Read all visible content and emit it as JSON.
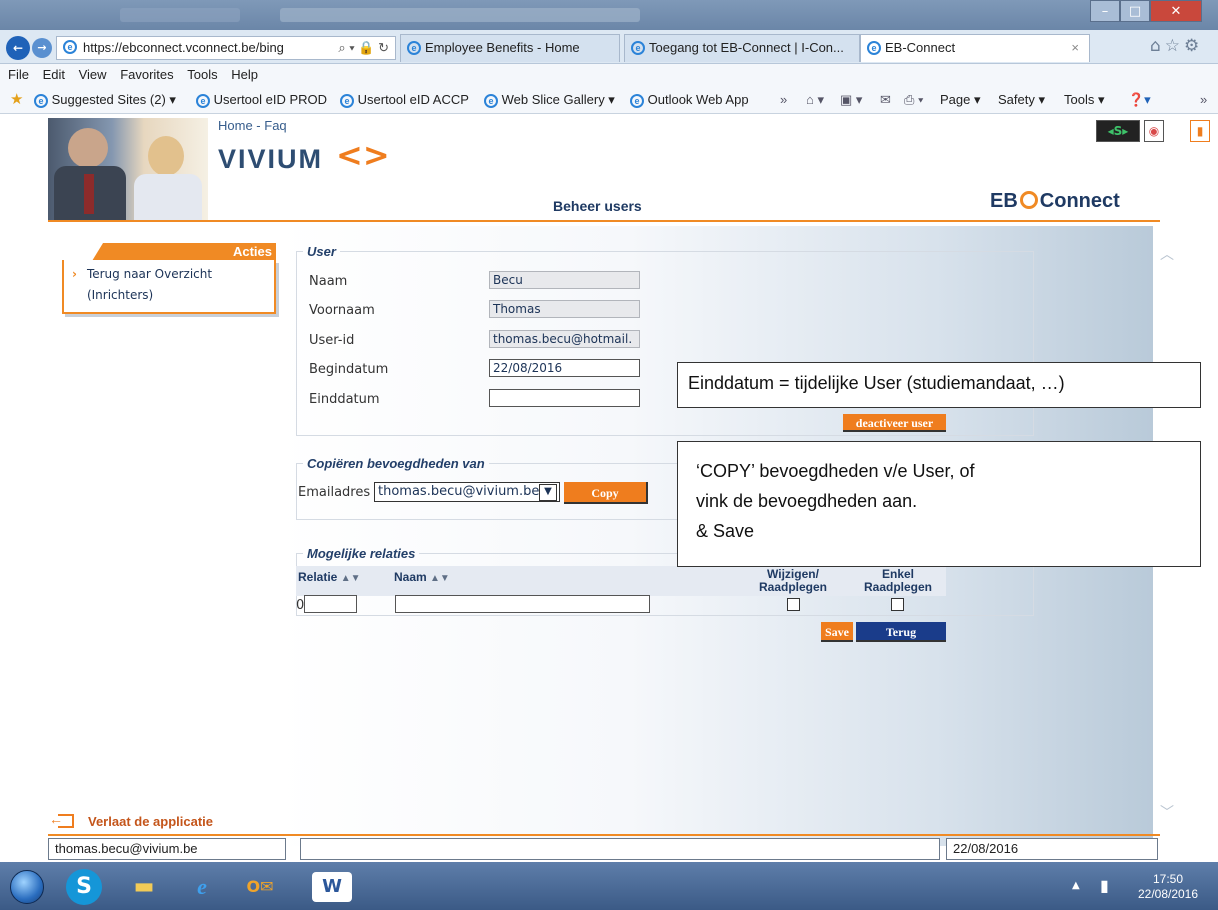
{
  "browser": {
    "url": "https://ebconnect.vconnect.be/bing",
    "tabs": [
      {
        "label": "Employee Benefits - Home"
      },
      {
        "label": "Toegang tot EB-Connect | I-Con..."
      },
      {
        "label": "EB-Connect"
      }
    ],
    "menu": [
      "File",
      "Edit",
      "View",
      "Favorites",
      "Tools",
      "Help"
    ],
    "favorites": [
      "Suggested Sites (2) ▾",
      "Usertool eID PROD",
      "Usertool eID ACCP",
      "Web Slice Gallery ▾",
      "Outlook Web App"
    ],
    "command_bar": [
      "Page ▾",
      "Safety ▾",
      "Tools ▾"
    ]
  },
  "header": {
    "nav_home": "Home",
    "nav_sep": " - ",
    "nav_faq": "Faq",
    "logo": "VIVIUM",
    "page_title": "Beheer users",
    "brand_left": "EB",
    "brand_right": "Connect"
  },
  "sidebar": {
    "title": "Acties",
    "link": "Terug naar Overzicht (Inrichters)"
  },
  "user_section": {
    "legend": "User",
    "fields": [
      {
        "label": "Naam",
        "value": "Becu"
      },
      {
        "label": "Voornaam",
        "value": "Thomas"
      },
      {
        "label": "User-id",
        "value": "thomas.becu@hotmail."
      },
      {
        "label": "Begindatum",
        "value": "22/08/2016"
      },
      {
        "label": "Einddatum",
        "value": ""
      }
    ],
    "deactivate_label": "deactiveer user"
  },
  "copy_section": {
    "legend": "Copiëren bevoegdheden van",
    "email_label": "Emailadres",
    "email_selected": "thomas.becu@vivium.be",
    "copy_label": "Copy"
  },
  "relations": {
    "legend": "Mogelijke relaties",
    "col_relatie": "Relatie",
    "col_naam": "Naam",
    "col_wijzigen": "Wijzigen/ Raadplegen",
    "col_enkel": "Enkel Raadplegen",
    "row_prefix": "0",
    "save_label": "Save",
    "terug_label": "Terug"
  },
  "annotations": {
    "note1": "Einddatum = tijdelijke User (studiemandaat, …)",
    "note2_line1": "‘COPY’ bevoegdheden v/e User, of",
    "note2_line2": "vink de bevoegdheden aan.",
    "note2_line3": "& Save"
  },
  "footer": {
    "exit_label": "Verlaat de applicatie",
    "status_user": "thomas.becu@vivium.be",
    "status_middle": "",
    "status_date": "22/08/2016"
  },
  "taskbar": {
    "time": "17:50",
    "date": "22/08/2016"
  }
}
